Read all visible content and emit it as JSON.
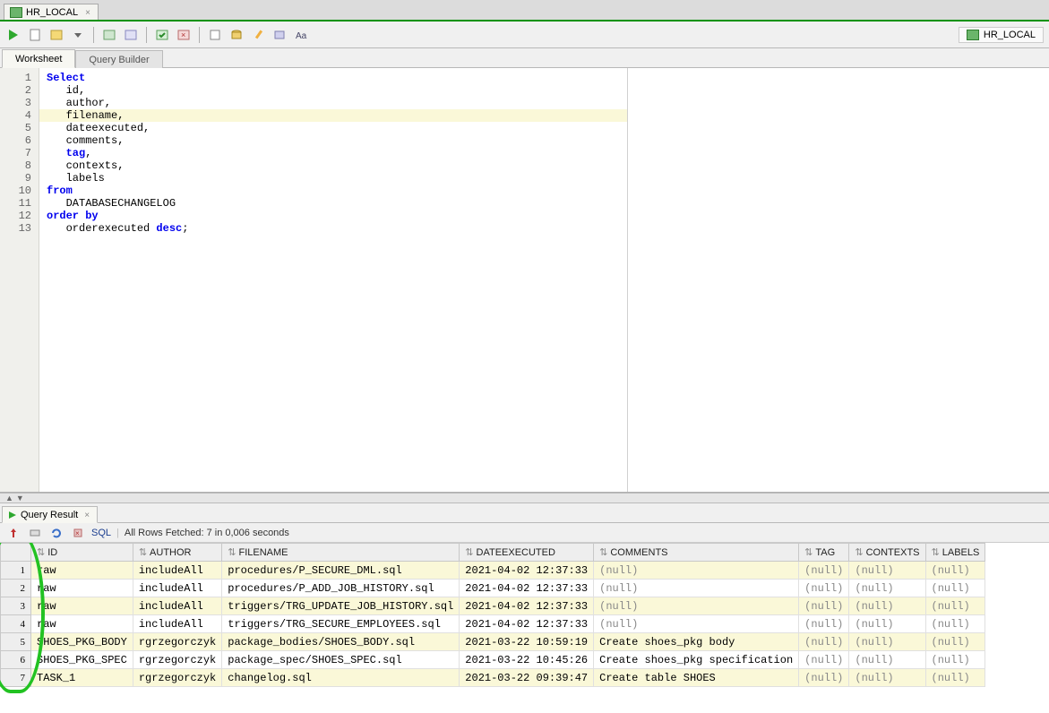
{
  "file_tab": {
    "label": "HR_LOCAL"
  },
  "connection_badge": {
    "label": "HR_LOCAL"
  },
  "secondary_tabs": {
    "worksheet": "Worksheet",
    "query_builder": "Query Builder"
  },
  "editor": {
    "lines": [
      {
        "t": "Select",
        "cls": "kw"
      },
      {
        "t": "   id,",
        "cls": ""
      },
      {
        "t": "   author,",
        "cls": ""
      },
      {
        "t": "   filename,",
        "cls": "",
        "highlight": true
      },
      {
        "t": "   dateexecuted,",
        "cls": ""
      },
      {
        "t": "   comments,",
        "cls": ""
      },
      {
        "t": "   tag,",
        "cls": "kw2"
      },
      {
        "t": "   contexts,",
        "cls": ""
      },
      {
        "t": "   labels",
        "cls": ""
      },
      {
        "t": "from",
        "cls": "kw"
      },
      {
        "t": "   DATABASECHANGELOG",
        "cls": ""
      },
      {
        "t": "order by",
        "cls": "kw"
      },
      {
        "t": "   orderexecuted desc;",
        "cls": "kw3"
      }
    ]
  },
  "result_tab": {
    "label": "Query Result"
  },
  "result_toolbar": {
    "sql_link": "SQL",
    "status": "All Rows Fetched: 7 in 0,006 seconds"
  },
  "grid": {
    "columns": [
      "ID",
      "AUTHOR",
      "FILENAME",
      "DATEEXECUTED",
      "COMMENTS",
      "TAG",
      "CONTEXTS",
      "LABELS"
    ],
    "rows": [
      {
        "n": 1,
        "ID": "raw",
        "AUTHOR": "includeAll",
        "FILENAME": "procedures/P_SECURE_DML.sql",
        "DATEEXECUTED": "2021-04-02 12:37:33",
        "COMMENTS": "(null)",
        "TAG": "(null)",
        "CONTEXTS": "(null)",
        "LABELS": "(null)"
      },
      {
        "n": 2,
        "ID": "raw",
        "AUTHOR": "includeAll",
        "FILENAME": "procedures/P_ADD_JOB_HISTORY.sql",
        "DATEEXECUTED": "2021-04-02 12:37:33",
        "COMMENTS": "(null)",
        "TAG": "(null)",
        "CONTEXTS": "(null)",
        "LABELS": "(null)"
      },
      {
        "n": 3,
        "ID": "raw",
        "AUTHOR": "includeAll",
        "FILENAME": "triggers/TRG_UPDATE_JOB_HISTORY.sql",
        "DATEEXECUTED": "2021-04-02 12:37:33",
        "COMMENTS": "(null)",
        "TAG": "(null)",
        "CONTEXTS": "(null)",
        "LABELS": "(null)"
      },
      {
        "n": 4,
        "ID": "raw",
        "AUTHOR": "includeAll",
        "FILENAME": "triggers/TRG_SECURE_EMPLOYEES.sql",
        "DATEEXECUTED": "2021-04-02 12:37:33",
        "COMMENTS": "(null)",
        "TAG": "(null)",
        "CONTEXTS": "(null)",
        "LABELS": "(null)"
      },
      {
        "n": 5,
        "ID": "SHOES_PKG_BODY",
        "AUTHOR": "rgrzegorczyk",
        "FILENAME": "package_bodies/SHOES_BODY.sql",
        "DATEEXECUTED": "2021-03-22 10:59:19",
        "COMMENTS": "Create shoes_pkg body",
        "TAG": "(null)",
        "CONTEXTS": "(null)",
        "LABELS": "(null)"
      },
      {
        "n": 6,
        "ID": "SHOES_PKG_SPEC",
        "AUTHOR": "rgrzegorczyk",
        "FILENAME": "package_spec/SHOES_SPEC.sql",
        "DATEEXECUTED": "2021-03-22 10:45:26",
        "COMMENTS": "Create shoes_pkg specification",
        "TAG": "(null)",
        "CONTEXTS": "(null)",
        "LABELS": "(null)"
      },
      {
        "n": 7,
        "ID": "TASK_1",
        "AUTHOR": "rgrzegorczyk",
        "FILENAME": "changelog.sql",
        "DATEEXECUTED": "2021-03-22 09:39:47",
        "COMMENTS": "Create table SHOES",
        "TAG": "(null)",
        "CONTEXTS": "(null)",
        "LABELS": "(null)"
      }
    ]
  }
}
